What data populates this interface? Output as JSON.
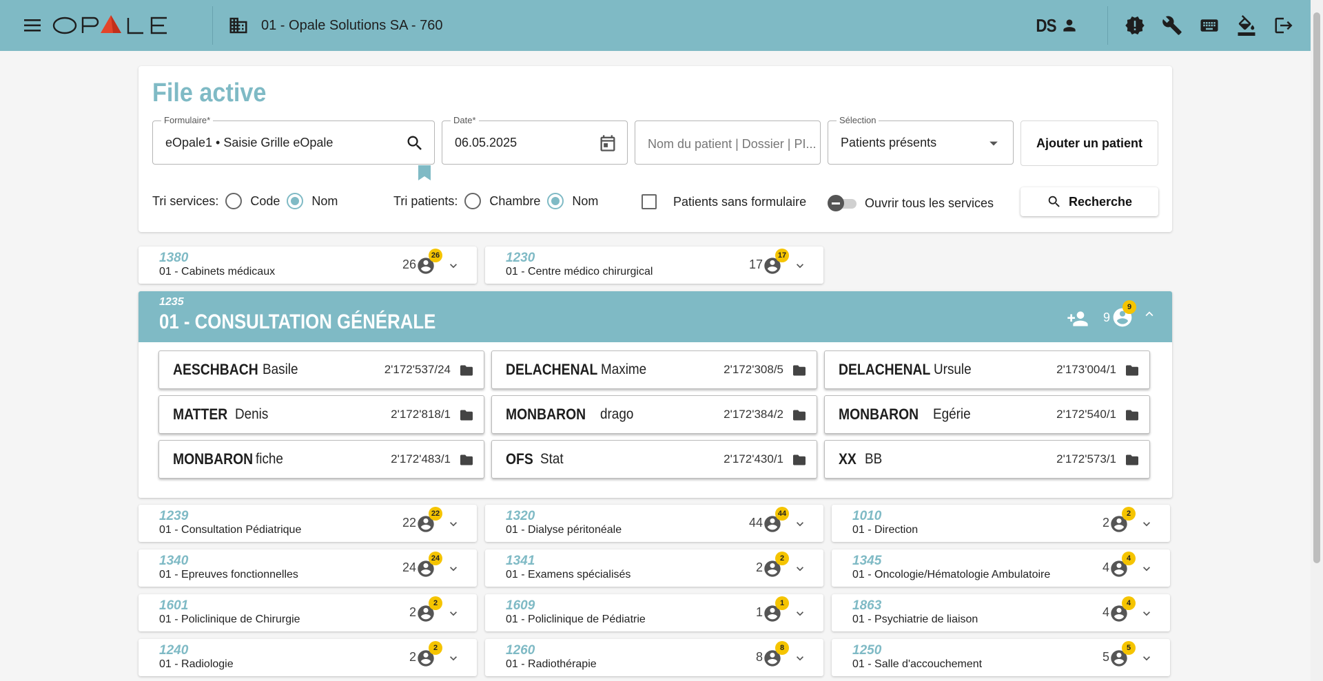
{
  "header": {
    "logo_text": "OPALE",
    "organization": "01 -  Opale Solutions SA - 760",
    "user_initials": "DS"
  },
  "colors": {
    "accent": "#7fbac5",
    "badge": "#f5c400",
    "text_dark": "#1e1e1e"
  },
  "search": {
    "title": "File active",
    "form_label": "Formulaire*",
    "form_value": "eOpale1  • Saisie Grille eOpale",
    "date_label": "Date*",
    "date_value": "06.05.2025",
    "patient_placeholder": "Nom du patient | Dossier | PI...",
    "selection_label": "Sélection",
    "selection_value": "Patients présents",
    "add_patient": "Ajouter un patient",
    "sort_services_label": "Tri services:",
    "sort_services_code": "Code",
    "sort_services_name": "Nom",
    "sort_services_selected": "Nom",
    "sort_patients_label": "Tri patients:",
    "sort_patients_room": "Chambre",
    "sort_patients_name": "Nom",
    "sort_patients_selected": "Nom",
    "no_form_label": "Patients sans formulaire",
    "no_form_checked": false,
    "open_all_label": "Ouvrir tous les services",
    "open_all_on": false,
    "search_button": "Recherche"
  },
  "services_top": [
    {
      "code": "1380",
      "name": "01 - Cabinets médicaux",
      "count": "26",
      "badge": "26"
    },
    {
      "code": "1230",
      "name": "01 - Centre médico chirurgical",
      "count": "17",
      "badge": "17"
    }
  ],
  "expanded": {
    "code": "1235",
    "name": "01 - CONSULTATION GÉNÉRALE",
    "count": "9",
    "badge": "9",
    "patients": [
      {
        "last": "AESCHBACH",
        "first": "Basile",
        "id": "2'172'537/24"
      },
      {
        "last": "DELACHENAL",
        "first": "Maxime",
        "id": "2'172'308/5"
      },
      {
        "last": "DELACHENAL",
        "first": "Ursule",
        "id": "2'173'004/1"
      },
      {
        "last": "MATTER",
        "first": "Denis",
        "id": "2'172'818/1"
      },
      {
        "last": "MONBARON",
        "first": "drago",
        "id": "2'172'384/2"
      },
      {
        "last": "MONBARON",
        "first": "Egérie",
        "id": "2'172'540/1"
      },
      {
        "last": "MONBARON",
        "first": "fiche",
        "id": "2'172'483/1"
      },
      {
        "last": "OFS",
        "first": "Stat",
        "id": "2'172'430/1"
      },
      {
        "last": "XX",
        "first": "BB",
        "id": "2'172'573/1"
      }
    ]
  },
  "services": [
    {
      "code": "1239",
      "name": "01 - Consultation Pédiatrique",
      "count": "22",
      "badge": "22"
    },
    {
      "code": "1320",
      "name": "01 - Dialyse péritonéale",
      "count": "44",
      "badge": "44"
    },
    {
      "code": "1010",
      "name": "01 - Direction",
      "count": "2",
      "badge": "2"
    },
    {
      "code": "1340",
      "name": "01 - Epreuves fonctionnelles",
      "count": "24",
      "badge": "24"
    },
    {
      "code": "1341",
      "name": "01 - Examens spécialisés",
      "count": "2",
      "badge": "2"
    },
    {
      "code": "1345",
      "name": "01 - Oncologie/Hématologie Ambulatoire",
      "count": "4",
      "badge": "4"
    },
    {
      "code": "1601",
      "name": "01 - Policlinique de Chirurgie",
      "count": "2",
      "badge": "2"
    },
    {
      "code": "1609",
      "name": "01 - Policlinique de Pédiatrie",
      "count": "1",
      "badge": "1"
    },
    {
      "code": "1863",
      "name": "01 - Psychiatrie de liaison",
      "count": "4",
      "badge": "4"
    },
    {
      "code": "1240",
      "name": "01 - Radiologie",
      "count": "2",
      "badge": "2"
    },
    {
      "code": "1260",
      "name": "01 - Radiothérapie",
      "count": "8",
      "badge": "8"
    },
    {
      "code": "1250",
      "name": "01 - Salle d'accouchement",
      "count": "5",
      "badge": "5"
    }
  ]
}
